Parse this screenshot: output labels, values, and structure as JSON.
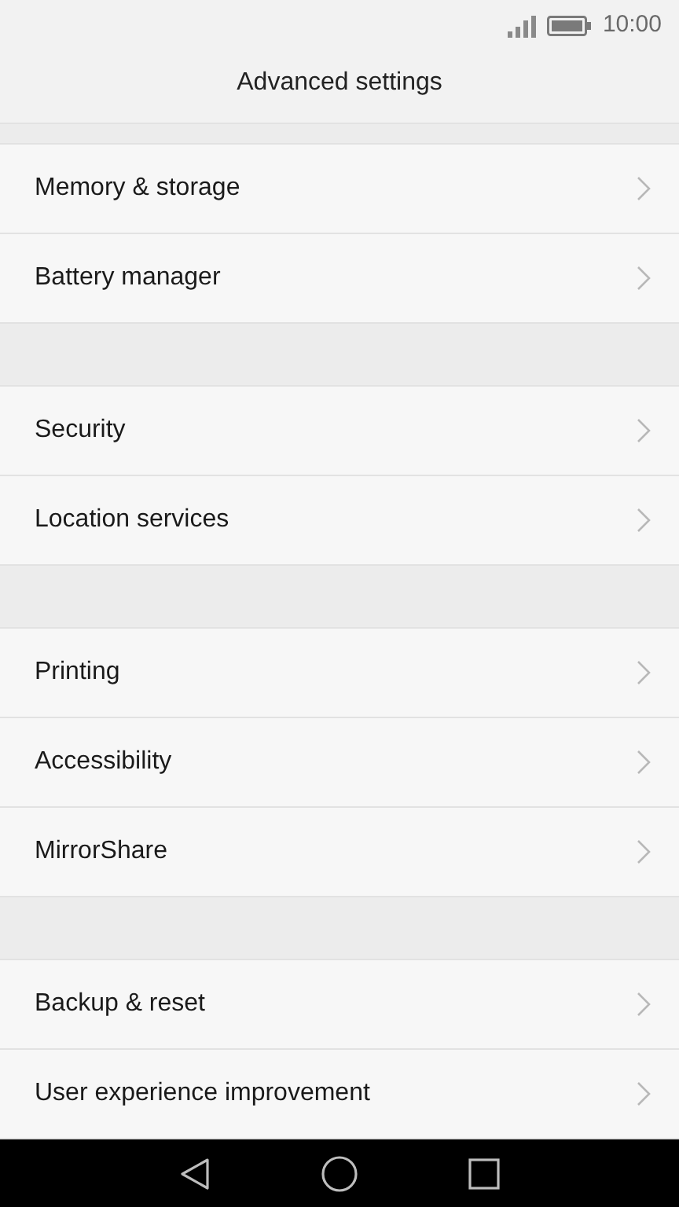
{
  "status_bar": {
    "time": "10:00"
  },
  "title": "Advanced settings",
  "groups": [
    {
      "items": [
        {
          "label": "Memory & storage"
        },
        {
          "label": "Battery manager"
        }
      ]
    },
    {
      "items": [
        {
          "label": "Security"
        },
        {
          "label": "Location services"
        }
      ]
    },
    {
      "items": [
        {
          "label": "Printing"
        },
        {
          "label": "Accessibility"
        },
        {
          "label": "MirrorShare"
        }
      ]
    },
    {
      "items": [
        {
          "label": "Backup & reset"
        },
        {
          "label": "User experience improvement"
        }
      ]
    }
  ]
}
